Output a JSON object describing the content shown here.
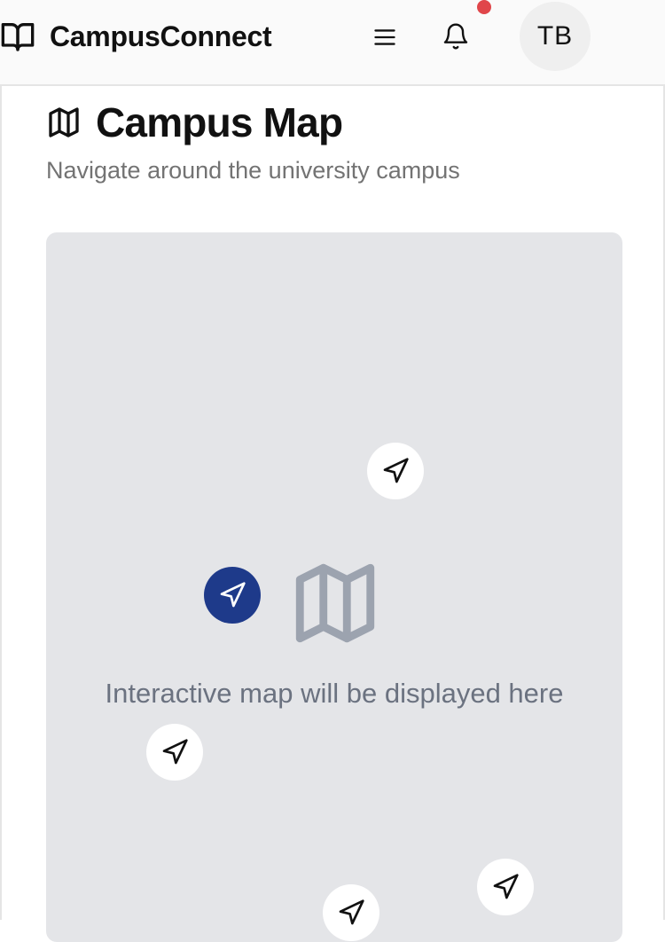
{
  "header": {
    "brand_name": "CampusConnect",
    "brand_icon": "open-book-icon",
    "menu_icon": "hamburger-menu-icon",
    "notification_icon": "bell-icon",
    "notification_dot_color": "#e0464a",
    "avatar_initials": "TB"
  },
  "page": {
    "title": "Campus Map",
    "title_icon": "map-icon",
    "subtitle": "Navigate around the university campus"
  },
  "map": {
    "placeholder_text": "Interactive map will be displayed here",
    "center_icon": "map-icon",
    "marker_icon": "navigation-arrow-icon",
    "markers": [
      {
        "id": "marker-1",
        "active": false
      },
      {
        "id": "marker-2",
        "active": true
      },
      {
        "id": "marker-3",
        "active": false
      },
      {
        "id": "marker-4",
        "active": false
      },
      {
        "id": "marker-5",
        "active": false
      }
    ],
    "active_color": "#1e3a8a",
    "background_color": "#e4e5e8"
  }
}
